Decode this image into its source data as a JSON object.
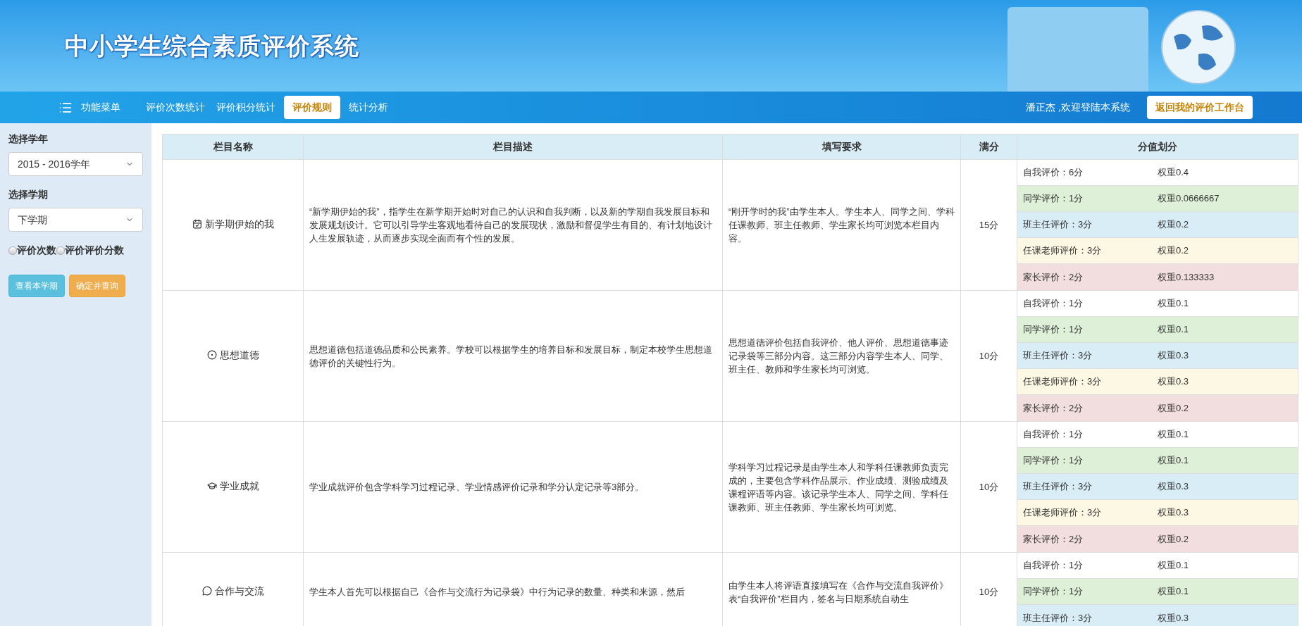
{
  "header": {
    "title": "中小学生综合素质评价系统"
  },
  "nav": {
    "menu_label": "功能菜单",
    "items": [
      {
        "label": "评价次数统计",
        "selected": false
      },
      {
        "label": "评价积分统计",
        "selected": false
      },
      {
        "label": "评价规则",
        "selected": true
      },
      {
        "label": "统计分析",
        "selected": false
      }
    ],
    "welcome": "潘正杰 ,欢迎登陆本系统",
    "return_button": "返回我的评价工作台"
  },
  "sidebar": {
    "year_label": "选择学年",
    "year_value": "2015 - 2016学年",
    "term_label": "选择学期",
    "term_value": "下学期",
    "radios": [
      {
        "label": "评价次数",
        "selected": false
      },
      {
        "label": "评价评价分数",
        "selected": false
      }
    ],
    "buttons": [
      {
        "label": "查看本学期",
        "kind": "info"
      },
      {
        "label": "确定并查询",
        "kind": "warning"
      }
    ]
  },
  "table": {
    "columns": [
      "栏目名称",
      "栏目描述",
      "填写要求",
      "满分",
      "分值划分"
    ],
    "rows": [
      {
        "kind": "calendar",
        "name": "新学期伊始的我",
        "description": "“新学期伊始的我”，指学生在新学期开始时对自己的认识和自我判断，以及新的学期自我发展目标和发展规划设计。它可以引导学生客观地看待自己的发展现状，激励和督促学生有目的、有计划地设计人生发展轨迹，从而逐步实现全面而有个性的发展。",
        "requirement": "“刚开学时的我”由学生本人。学生本人、同学之间、学科任课教师、班主任教师、学生家长均可浏览本栏目内容。",
        "full": "15分",
        "weights": [
          {
            "label": "自我评价：6分",
            "weight": "权重0.4",
            "color": "#ffffff"
          },
          {
            "label": "同学评价：1分",
            "weight": "权重0.0666667",
            "color": "#dff0d8"
          },
          {
            "label": "班主任评价：3分",
            "weight": "权重0.2",
            "color": "#d9edf7"
          },
          {
            "label": "任课老师评价：3分",
            "weight": "权重0.2",
            "color": "#fcf8e3"
          },
          {
            "label": "家长评价：2分",
            "weight": "权重0.133333",
            "color": "#f2dede"
          }
        ]
      },
      {
        "kind": "target",
        "name": "思想道德",
        "description": "思想道德包括道德品质和公民素养。学校可以根据学生的培养目标和发展目标，制定本校学生思想道德评价的关键性行为。",
        "requirement": "思想道德评价包括自我评价、他人评价、思想道德事迹记录袋等三部分内容。这三部分内容学生本人、同学、班主任、教师和学生家长均可浏览。",
        "full": "10分",
        "weights": [
          {
            "label": "自我评价：1分",
            "weight": "权重0.1",
            "color": "#ffffff"
          },
          {
            "label": "同学评价：1分",
            "weight": "权重0.1",
            "color": "#dff0d8"
          },
          {
            "label": "班主任评价：3分",
            "weight": "权重0.3",
            "color": "#d9edf7"
          },
          {
            "label": "任课老师评价：3分",
            "weight": "权重0.3",
            "color": "#fcf8e3"
          },
          {
            "label": "家长评价：2分",
            "weight": "权重0.2",
            "color": "#f2dede"
          }
        ]
      },
      {
        "kind": "cap",
        "name": "学业成就",
        "description": "学业成就评价包含学科学习过程记录、学业情感评价记录和学分认定记录等3部分。",
        "requirement": "学科学习过程记录是由学生本人和学科任课教师负责完成的，主要包含学科作品展示、作业成绩、测验成绩及课程评语等内容。该记录学生本人、同学之间、学科任课教师、班主任教师、学生家长均可浏览。",
        "full": "10分",
        "weights": [
          {
            "label": "自我评价：1分",
            "weight": "权重0.1",
            "color": "#ffffff"
          },
          {
            "label": "同学评价：1分",
            "weight": "权重0.1",
            "color": "#dff0d8"
          },
          {
            "label": "班主任评价：3分",
            "weight": "权重0.3",
            "color": "#d9edf7"
          },
          {
            "label": "任课老师评价：3分",
            "weight": "权重0.3",
            "color": "#fcf8e3"
          },
          {
            "label": "家长评价：2分",
            "weight": "权重0.2",
            "color": "#f2dede"
          }
        ]
      },
      {
        "kind": "comment",
        "name": "合作与交流",
        "description": "学生本人首先可以根据自己《合作与交流行为记录袋》中行为记录的数量、种类和来源，然后",
        "requirement": "由学生本人将评语直接填写在《合作与交流自我评价》表“自我评价”栏目内，签名与日期系统自动生",
        "full": "10分",
        "weights": [
          {
            "label": "自我评价：1分",
            "weight": "权重0.1",
            "color": "#ffffff"
          },
          {
            "label": "同学评价：1分",
            "weight": "权重0.1",
            "color": "#dff0d8"
          },
          {
            "label": "班主任评价：3分",
            "weight": "权重0.3",
            "color": "#d9edf7"
          }
        ]
      }
    ]
  }
}
